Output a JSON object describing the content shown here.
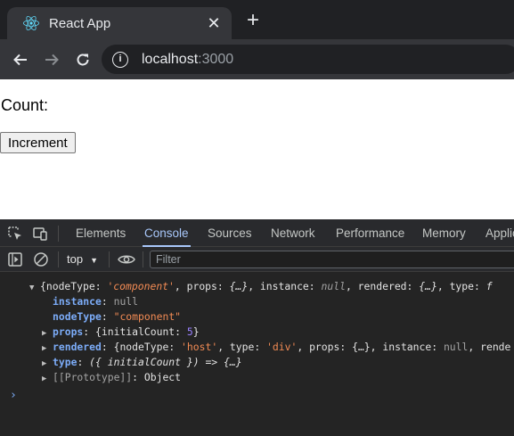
{
  "browser": {
    "tab_title": "React App",
    "tab_close": "✕",
    "new_tab": "+",
    "url_host": "localhost",
    "url_port": ":3000"
  },
  "page": {
    "count_label": "Count:",
    "increment_label": "Increment"
  },
  "devtools": {
    "tabs": [
      "Elements",
      "Console",
      "Sources",
      "Network",
      "Performance",
      "Memory",
      "Applic"
    ],
    "active_tab": "Console",
    "context": "top",
    "filter_placeholder": "Filter",
    "console": {
      "summary": {
        "open": "{",
        "k1": "nodeType",
        "v1": "'component'",
        "k2": "props",
        "v2": "{…}",
        "k3": "instance",
        "v3": "null",
        "k4": "rendered",
        "v4": "{…}",
        "k5": "type",
        "v5": "f"
      },
      "instance_key": "instance",
      "instance_val": "null",
      "nodeType_key": "nodeType",
      "nodeType_val": "\"component\"",
      "props_key": "props",
      "props_prefix": "{initialCount: ",
      "props_num": "5",
      "props_suffix": "}",
      "rendered_key": "rendered",
      "rendered_a": "{nodeType: ",
      "rendered_host": "'host'",
      "rendered_b": ", type: ",
      "rendered_div": "'div'",
      "rendered_c": ", props: {…}, instance: ",
      "rendered_null": "null",
      "rendered_d": ", rende",
      "type_key": "type",
      "type_val": "({ initialCount }) => {…}",
      "proto_key": "[[Prototype]]",
      "proto_val": "Object",
      "prompt": "›"
    }
  }
}
